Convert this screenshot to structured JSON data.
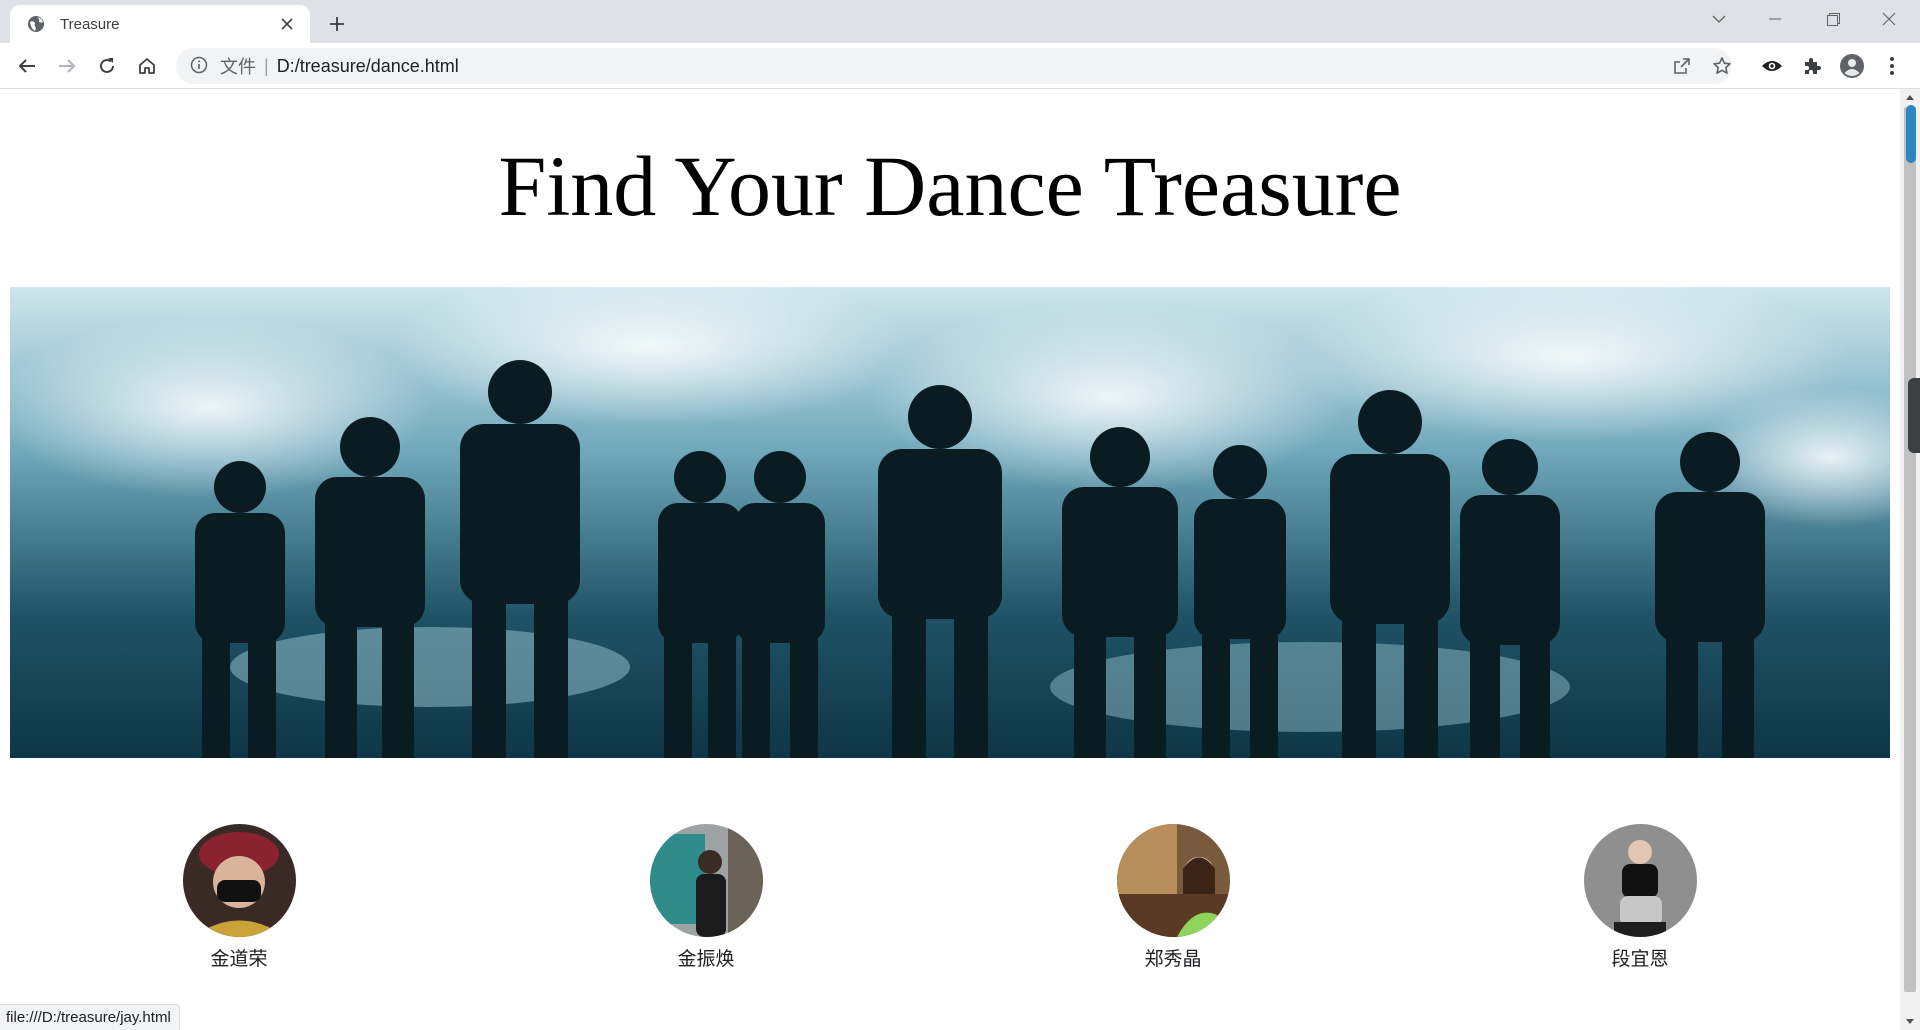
{
  "browser": {
    "tab": {
      "title": "Treasure",
      "favicon": "globe-icon",
      "close_icon": "close-icon"
    },
    "new_tab_icon": "plus-icon",
    "window_controls": [
      "tab-search-icon",
      "minimize-icon",
      "restore-icon",
      "close-icon"
    ],
    "address_bar": {
      "info_icon": "info-icon",
      "scheme_label": "文件",
      "separator": "|",
      "url": "D:/treasure/dance.html"
    },
    "toolbar_icons": [
      "back-icon",
      "forward-icon",
      "reload-icon",
      "home-icon",
      "share-icon",
      "bookmark-star-icon",
      "eye-icon",
      "extensions-icon",
      "profile-icon",
      "menu-icon"
    ]
  },
  "page": {
    "title": "Find Your Dance Treasure",
    "banner_alt": "",
    "members": [
      {
        "name": "金道荣"
      },
      {
        "name": "金振焕"
      },
      {
        "name": "郑秀晶"
      },
      {
        "name": "段宜恩"
      }
    ]
  },
  "status_bar": {
    "text": "file:///D:/treasure/jay.html"
  },
  "colors": {
    "tab_strip": "#dee1e6",
    "omnibox": "#f1f3f4",
    "scroll_marker": "#2b86c5"
  }
}
